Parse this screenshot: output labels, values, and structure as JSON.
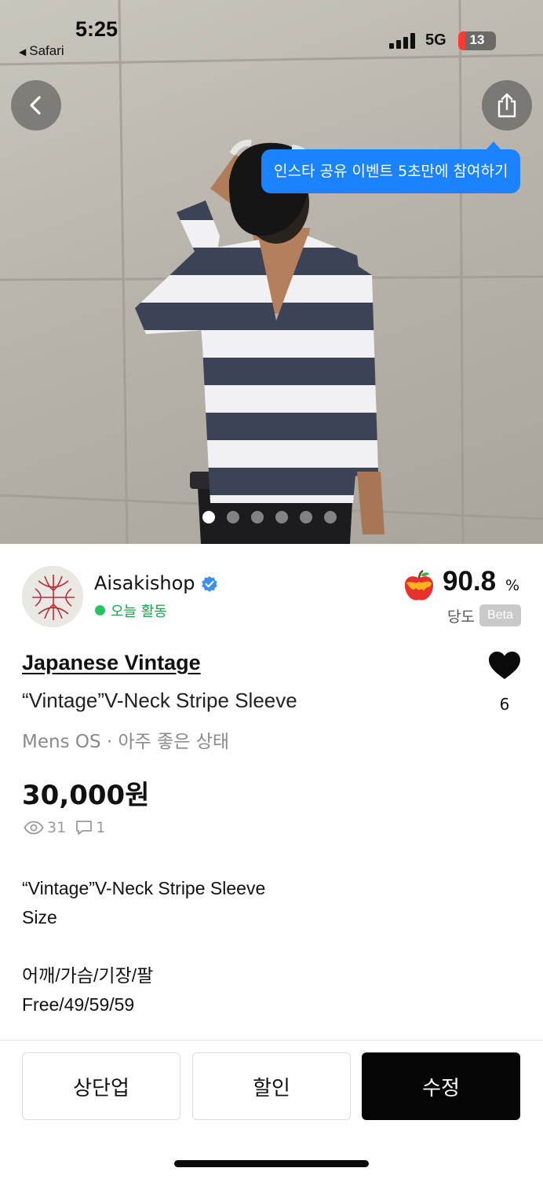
{
  "status_bar": {
    "time": "5:25",
    "back_app": "Safari",
    "network": "5G",
    "battery": "13"
  },
  "hero": {
    "photo_description_icon": "product-photo",
    "tooltip": "인스타 공유 이벤트 5초만에 참여하기",
    "page_count": 6,
    "active_page": 1
  },
  "seller": {
    "name": "Aisakishop",
    "verified_icon": "verified-badge-icon",
    "activity": "오늘 활동",
    "sweetness_value": "90.8",
    "sweetness_unit": "%",
    "sweetness_label": "당도",
    "beta_badge": "Beta"
  },
  "product": {
    "brand": "Japanese Vintage",
    "title": "“Vintage”V-Neck Stripe Sleeve",
    "meta": "Mens OS · 아주 좋은 상태",
    "price": "30,000원",
    "likes": "6",
    "views": "31",
    "comments": "1",
    "description": {
      "line1": "“Vintage”V-Neck Stripe Sleeve",
      "line2": "Size",
      "line3": "어깨/가슴/기장/팔",
      "line4": "Free/49/59/59"
    }
  },
  "actions": {
    "bump": "상단업",
    "discount": "할인",
    "edit": "수정"
  },
  "colors": {
    "accent_blue": "#1b83ff",
    "active_green": "#22c55e",
    "primary_button": "#050505"
  }
}
